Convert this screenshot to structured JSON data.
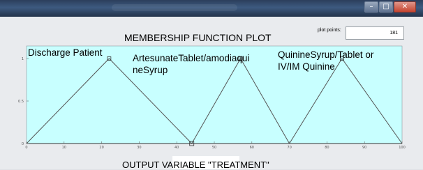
{
  "window": {
    "controls": [
      "minimize",
      "restore",
      "close"
    ]
  },
  "plot_points": {
    "label": "plot points:",
    "value": "181"
  },
  "chart_data": {
    "type": "line",
    "title": "MEMBERSHIP FUNCTION PLOT",
    "xlabel": "OUTPUT VARIABLE \"TREATMENT\"",
    "ylabel": "",
    "xlim": [
      0,
      100
    ],
    "ylim": [
      0,
      1
    ],
    "xticks": [
      "0",
      "10",
      "20",
      "30",
      "40",
      "50",
      "60",
      "70",
      "80",
      "90",
      "100"
    ],
    "yticks": [
      "0",
      "0.5",
      "1"
    ],
    "background": "#c8ffff",
    "line_color": "#555555",
    "grid": false,
    "series": [
      {
        "name": "Discharge Patient",
        "x": [
          0,
          22,
          44
        ],
        "y": [
          0,
          1,
          0
        ]
      },
      {
        "name": "ArtesunateTablet/amodiaquineSyrup",
        "x": [
          44,
          57,
          70
        ],
        "y": [
          0,
          1,
          0
        ]
      },
      {
        "name": "QuinineSyrup/Tablet or IV/IM Quinine",
        "x": [
          70,
          84,
          100
        ],
        "y": [
          0,
          1,
          0
        ]
      }
    ],
    "labels": [
      {
        "lines": [
          "Discharge Patient"
        ]
      },
      {
        "lines": [
          "ArtesunateTablet/amodiaqui",
          "neSyrup"
        ]
      },
      {
        "lines": [
          "QuinineSyrup/Tablet or",
          "IV/IM Quinine"
        ]
      }
    ]
  }
}
